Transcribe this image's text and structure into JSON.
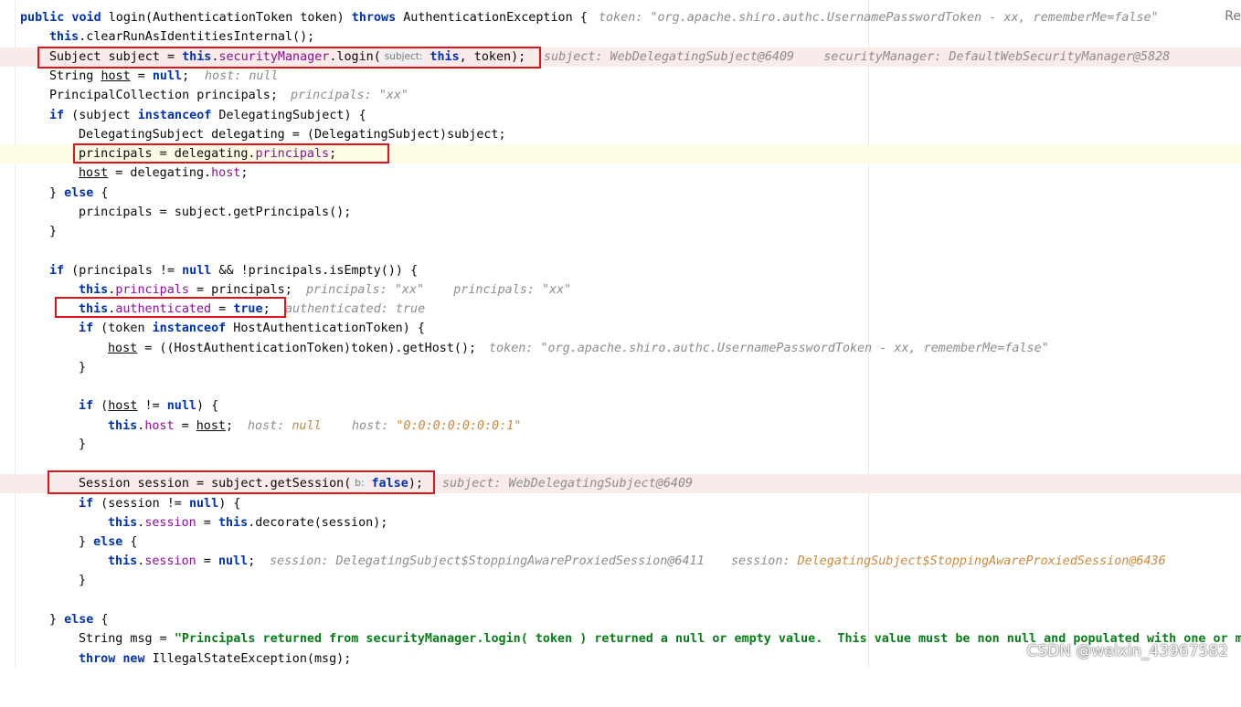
{
  "reader_mode_label": "Re",
  "watermark": "CSDN @weixin_43967582",
  "colors": {
    "keyword": "#0033b3",
    "field": "#871094",
    "string": "#067d17",
    "hint": "#8c8c8c",
    "hint_value_changed": "#c9893a",
    "highlight_box": "#e3131a"
  },
  "lines": {
    "l1": {
      "kw_public_void": "public void",
      "sig": " login(AuthenticationToken token) ",
      "kw_throws": "throws",
      "exc": " AuthenticationException {",
      "hint": "token: \"org.apache.shiro.authc.UsernamePasswordToken - xx, rememberMe=false\""
    },
    "l2": {
      "kw_this": "this",
      "rest": ".clearRunAsIdentitiesInternal();"
    },
    "l3": {
      "a": "Subject subject = ",
      "kw_this": "this",
      "dot": ".",
      "fld": "securityManager",
      "b": ".login(",
      "param_hint": "subject:",
      "kw_this2": "this",
      "c": ", token);",
      "hint": "subject: WebDelegatingSubject@6409    securityManager: DefaultWebSecurityManager@5828"
    },
    "l4": {
      "a": "String ",
      "var": "host",
      "b": " = ",
      "kw_null": "null",
      "c": ";",
      "hint": "host: null"
    },
    "l5": {
      "a": "PrincipalCollection principals;",
      "hint": "principals: \"xx\""
    },
    "l6": {
      "kw_if": "if",
      "a": " (subject ",
      "kw_instanceof": "instanceof",
      "b": " DelegatingSubject) {"
    },
    "l7": {
      "a": "DelegatingSubject delegating = (DelegatingSubject)subject;"
    },
    "l8": {
      "a": "principals = delegating.",
      "fld": "principals",
      "b": ";"
    },
    "l9": {
      "var": "host",
      "a": " = delegating.",
      "fld": "host",
      "b": ";"
    },
    "l10": {
      "a": "} ",
      "kw_else": "else",
      "b": " {"
    },
    "l11": {
      "a": "principals = subject.getPrincipals();"
    },
    "l12": {
      "a": "}"
    },
    "l14": {
      "kw_if": "if",
      "a": " (principals != ",
      "kw_null": "null",
      "b": " && !principals.isEmpty()) {"
    },
    "l15": {
      "kw_this": "this",
      "dot": ".",
      "fld": "principals",
      "a": " = principals;",
      "hint": "principals: \"xx\"    principals: \"xx\""
    },
    "l16": {
      "kw_this": "this",
      "dot": ".",
      "fld": "authenticated",
      "a": " = ",
      "kw_true": "true",
      "b": ";",
      "hint": "authenticated: true"
    },
    "l17": {
      "kw_if": "if",
      "a": " (token ",
      "kw_instanceof": "instanceof",
      "b": " HostAuthenticationToken) {"
    },
    "l18": {
      "var": "host",
      "a": " = ((HostAuthenticationToken)token).getHost();",
      "hint": "token: \"org.apache.shiro.authc.UsernamePasswordToken - xx, rememberMe=false\""
    },
    "l19": {
      "a": "}"
    },
    "l21": {
      "kw_if": "if",
      "a": " (",
      "var": "host",
      "b": " != ",
      "kw_null": "null",
      "c": ") {"
    },
    "l22": {
      "kw_this": "this",
      "dot": ".",
      "fld": "host",
      "a": " = ",
      "var": "host",
      "b": ";",
      "hint1": "host: ",
      "hint1_val": "null",
      "hint2": "host: ",
      "hint2_val": "\"0:0:0:0:0:0:0:1\""
    },
    "l23": {
      "a": "}"
    },
    "l25": {
      "a": "Session session = subject.getSession(",
      "param_hint": "b:",
      "kw_false": "false",
      "b": ");",
      "hint": "subject: WebDelegatingSubject@6409"
    },
    "l26": {
      "kw_if": "if",
      "a": " (session != ",
      "kw_null": "null",
      "b": ") {"
    },
    "l27": {
      "kw_this": "this",
      "dot": ".",
      "fld": "session",
      "a": " = ",
      "kw_this2": "this",
      "b": ".decorate(session);"
    },
    "l28": {
      "a": "} ",
      "kw_else": "else",
      "b": " {"
    },
    "l29": {
      "kw_this": "this",
      "dot": ".",
      "fld": "session",
      "a": " = ",
      "kw_null": "null",
      "b": ";",
      "hint1": "session: DelegatingSubject$StoppingAwareProxiedSession@6411",
      "hint2": "session: ",
      "hint2_val": "DelegatingSubject$StoppingAwareProxiedSession@6436"
    },
    "l30": {
      "a": "}"
    },
    "l32": {
      "a": "} ",
      "kw_else": "else",
      "b": " {"
    },
    "l33": {
      "a": "String msg = ",
      "str": "\"Principals returned from securityManager.login( token ) returned a null or empty value.  This value must be non null and populated with one or mo"
    },
    "l34": {
      "kw_throw": "throw",
      "a": " ",
      "kw_new": "new",
      "b": " IllegalStateException(msg);"
    }
  }
}
